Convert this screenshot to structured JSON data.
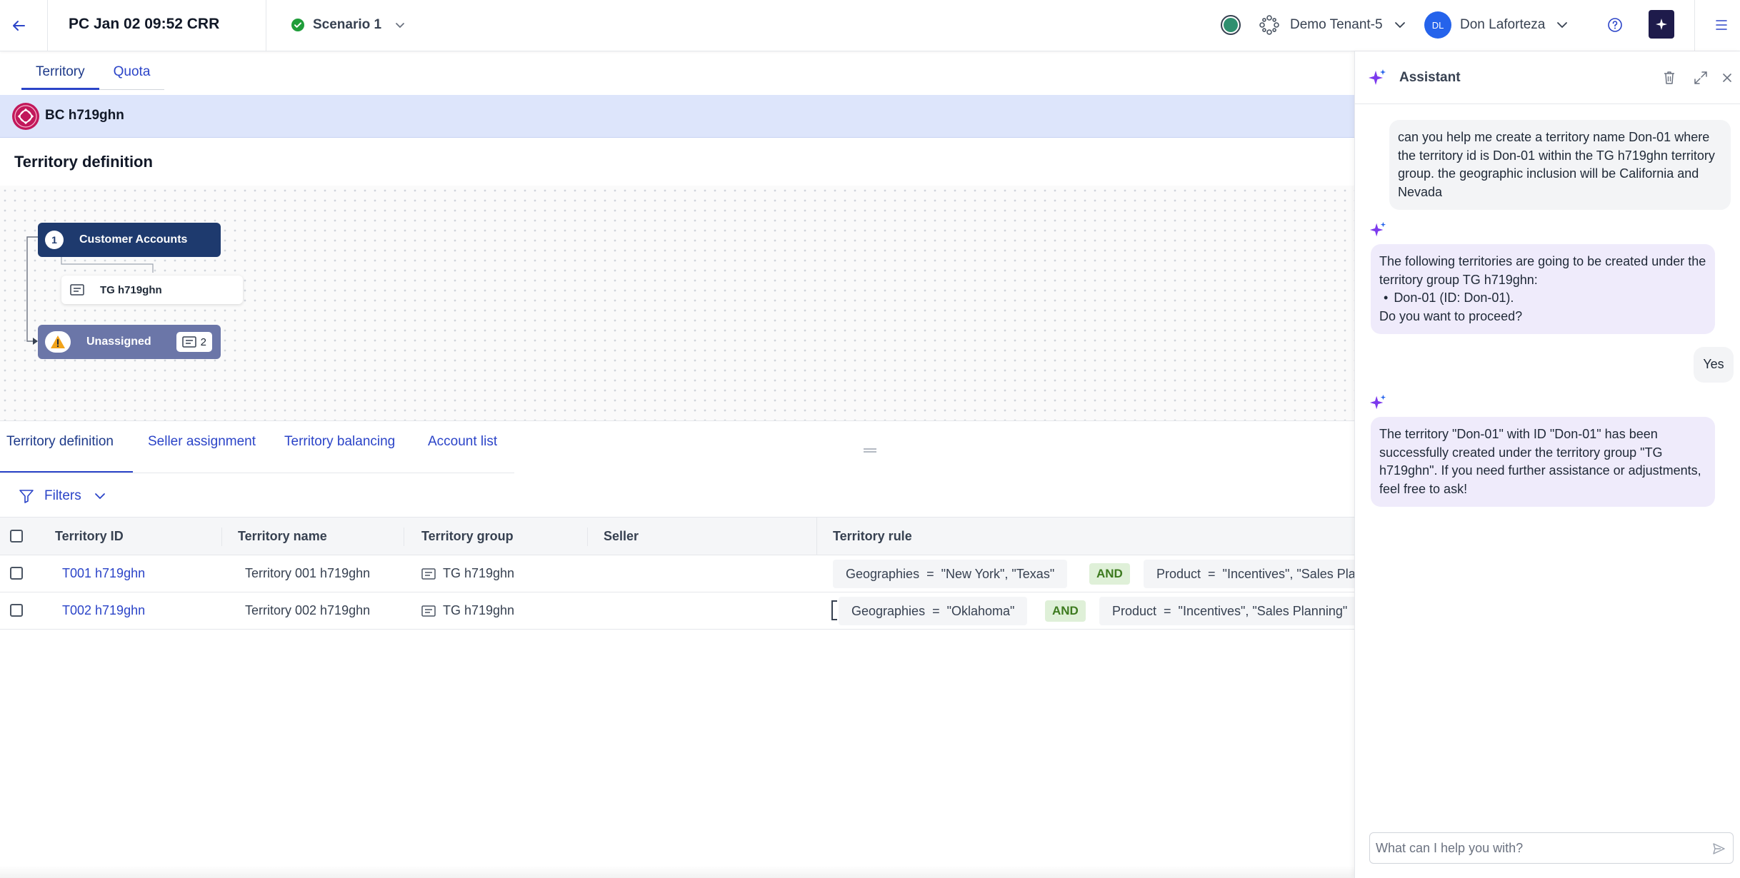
{
  "header": {
    "title": "PC Jan 02 09:52 CRR",
    "scenario": "Scenario 1",
    "tenant": "Demo Tenant-5",
    "user_initials": "DL",
    "user_name": "Don Laforteza"
  },
  "top_tabs": [
    "Territory",
    "Quota"
  ],
  "bc_title": "BC h719ghn",
  "definition_title": "Territory definition",
  "tree": {
    "root_number": "1",
    "root_label": "Customer Accounts",
    "group_label": "TG h719ghn",
    "unassigned_label": "Unassigned",
    "unassigned_count": "2"
  },
  "bottom_tabs": [
    "Territory definition",
    "Seller assignment",
    "Territory balancing",
    "Account list"
  ],
  "filters_label": "Filters",
  "table": {
    "columns": [
      "Territory ID",
      "Territory name",
      "Territory group",
      "Seller",
      "Territory rule"
    ],
    "rows": [
      {
        "id": "T001 h719ghn",
        "name": "Territory 001 h719ghn",
        "group": "TG h719ghn",
        "seller": "",
        "rule_geo": "Geographies  =  \"New York\", \"Texas\"",
        "rule_op": "AND",
        "rule_product": "Product  =  \"Incentives\", \"Sales Planning\""
      },
      {
        "id": "T002 h719ghn",
        "name": "Territory 002 h719ghn",
        "group": "TG h719ghn",
        "seller": "",
        "rule_geo": "Geographies  =  \"Oklahoma\"",
        "rule_op": "AND",
        "rule_product": "Product  =  \"Incentives\", \"Sales Planning\""
      }
    ]
  },
  "assistant": {
    "title": "Assistant",
    "messages": [
      {
        "role": "user",
        "text": "can you help me create a territory name Don-01 where the territory id is Don-01 within the TG h719ghn territory group. the geographic inclusion will be California and Nevada"
      },
      {
        "role": "ai",
        "line1": "The following territories are going to be created under the territory group TG h719ghn:",
        "bullet": "Don-01 (ID: Don-01).",
        "line3": "Do you want to proceed?"
      },
      {
        "role": "user",
        "text": "Yes"
      },
      {
        "role": "ai",
        "text": "The territory \"Don-01\" with ID \"Don-01\" has been successfully created under the territory group \"TG h719ghn\". If you need further assistance or adjustments, feel free to ask!"
      }
    ],
    "input_placeholder": "What can I help you with?"
  },
  "colors": {
    "accent": "#2b44c8",
    "node_dark": "#1e3a6e",
    "node_muted": "#6b76a8",
    "ai_bubble": "#efebfb",
    "sparkle": "#7c3aed",
    "success": "#1f9d3a"
  },
  "icons": [
    "back-arrow-icon",
    "check-circle-icon",
    "chevron-down-icon",
    "status-dot-icon",
    "tenant-icon",
    "help-icon",
    "assistant-sparkle-icon",
    "menu-icon",
    "trash-icon",
    "expand-icon",
    "close-icon",
    "filter-icon",
    "send-icon",
    "warning-icon",
    "territory-group-icon"
  ]
}
